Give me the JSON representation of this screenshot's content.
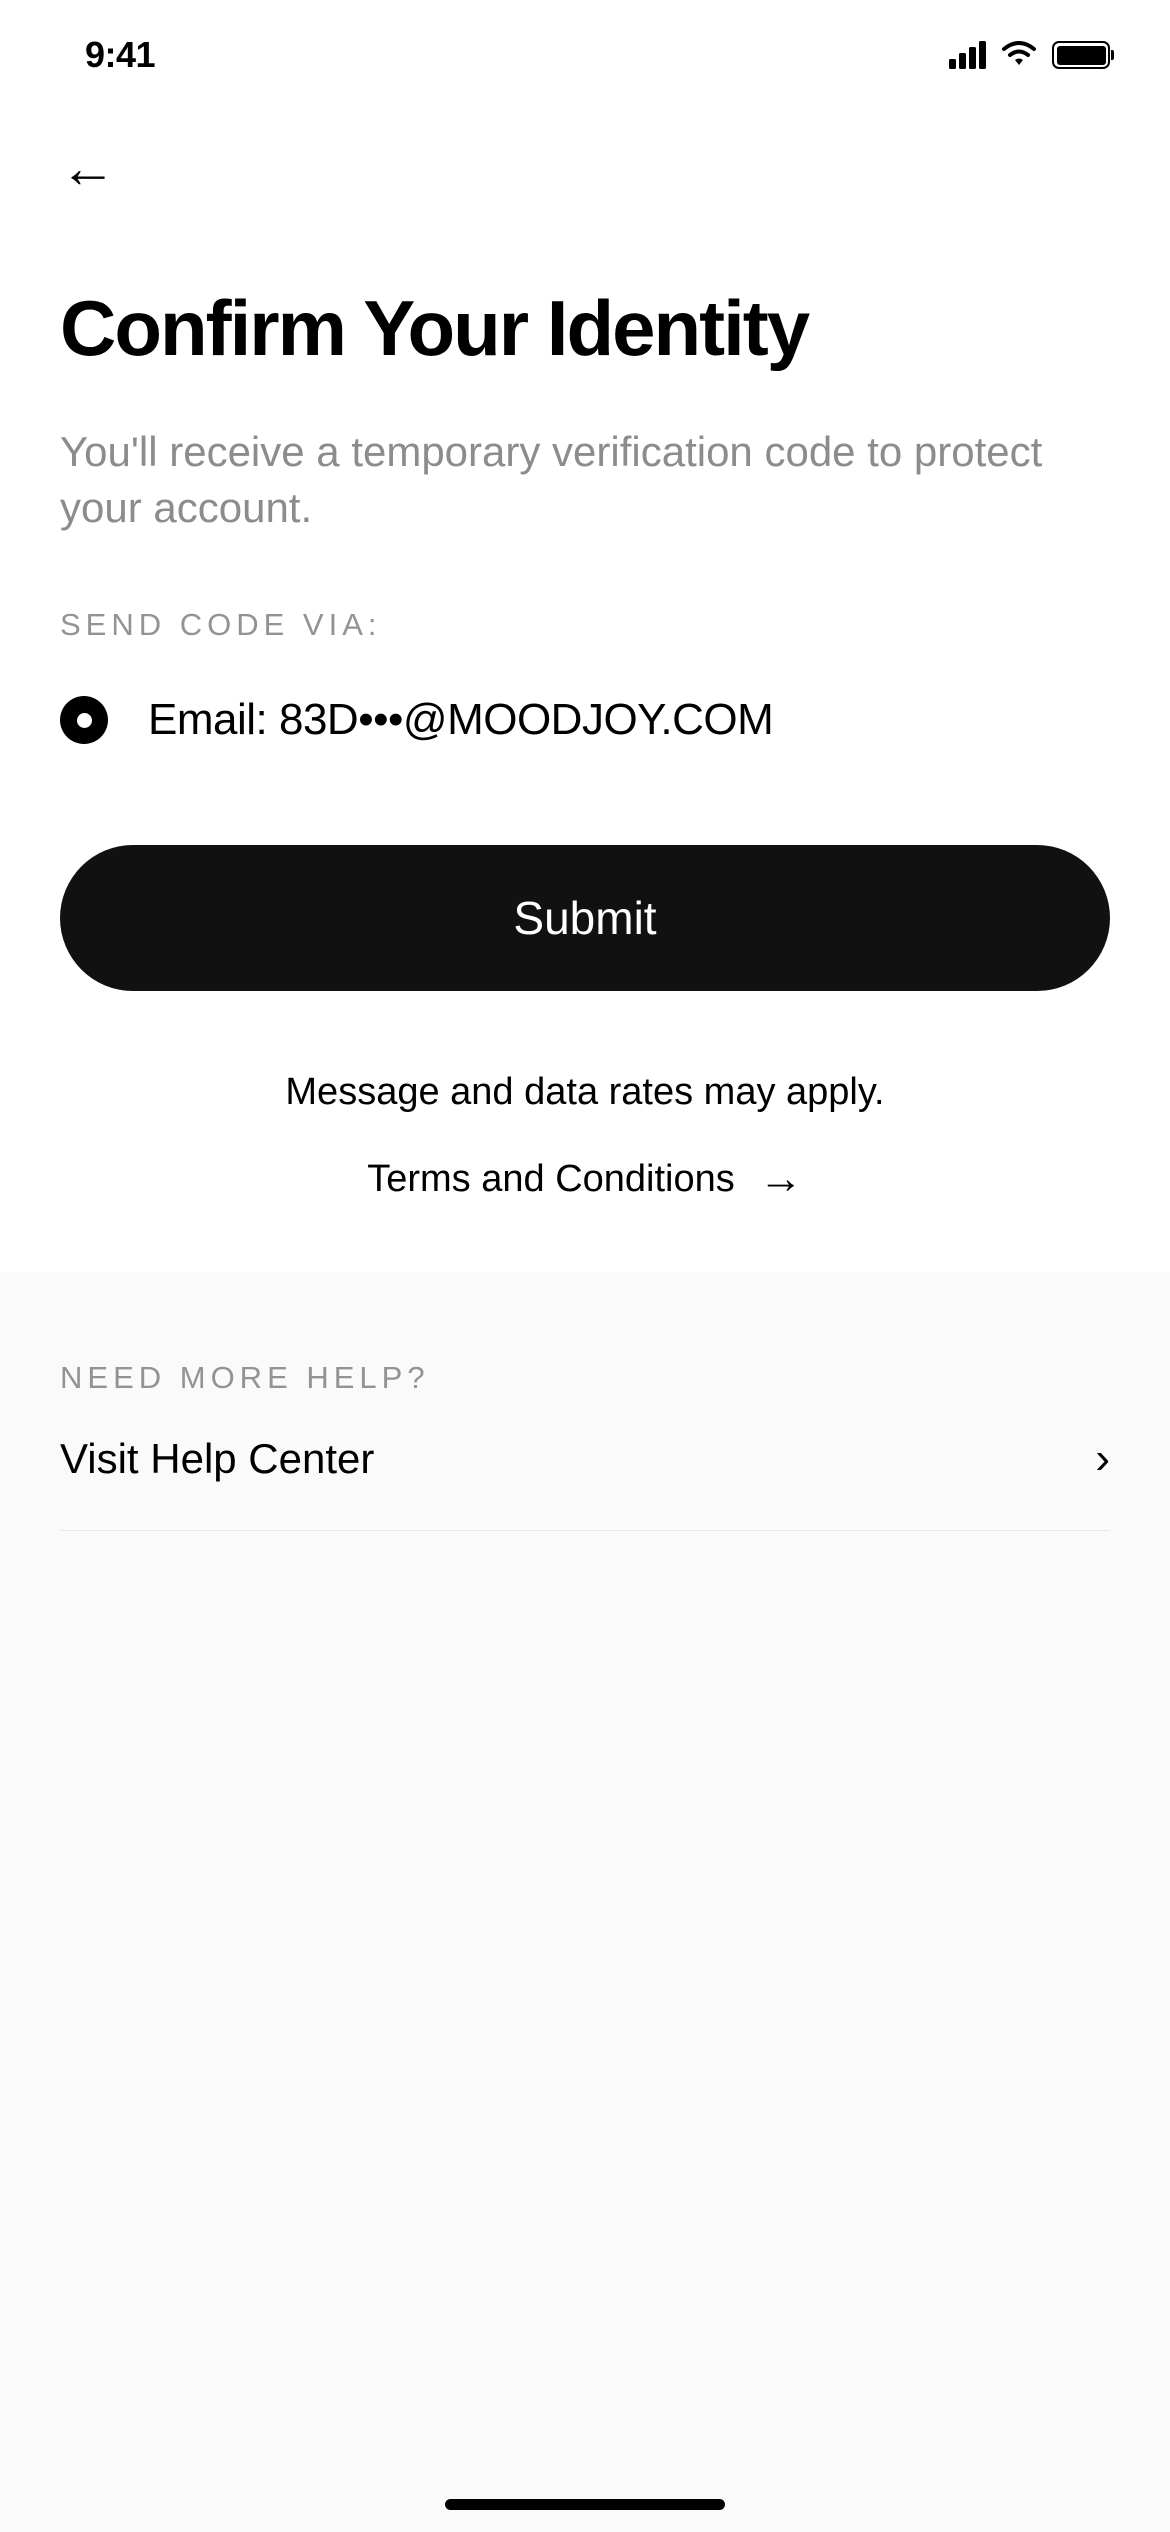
{
  "status": {
    "time": "9:41"
  },
  "header": {
    "title": "Confirm Your Identity",
    "subtitle": "You'll receive a temporary verification code to protect your account."
  },
  "sendCode": {
    "label": "SEND CODE VIA:",
    "option": "Email: 83D•••@MOODJOY.COM"
  },
  "actions": {
    "submit": "Submit",
    "disclaimer": "Message and data rates may apply.",
    "terms": "Terms and Conditions"
  },
  "help": {
    "label": "NEED MORE HELP?",
    "linkText": "Visit Help Center"
  }
}
